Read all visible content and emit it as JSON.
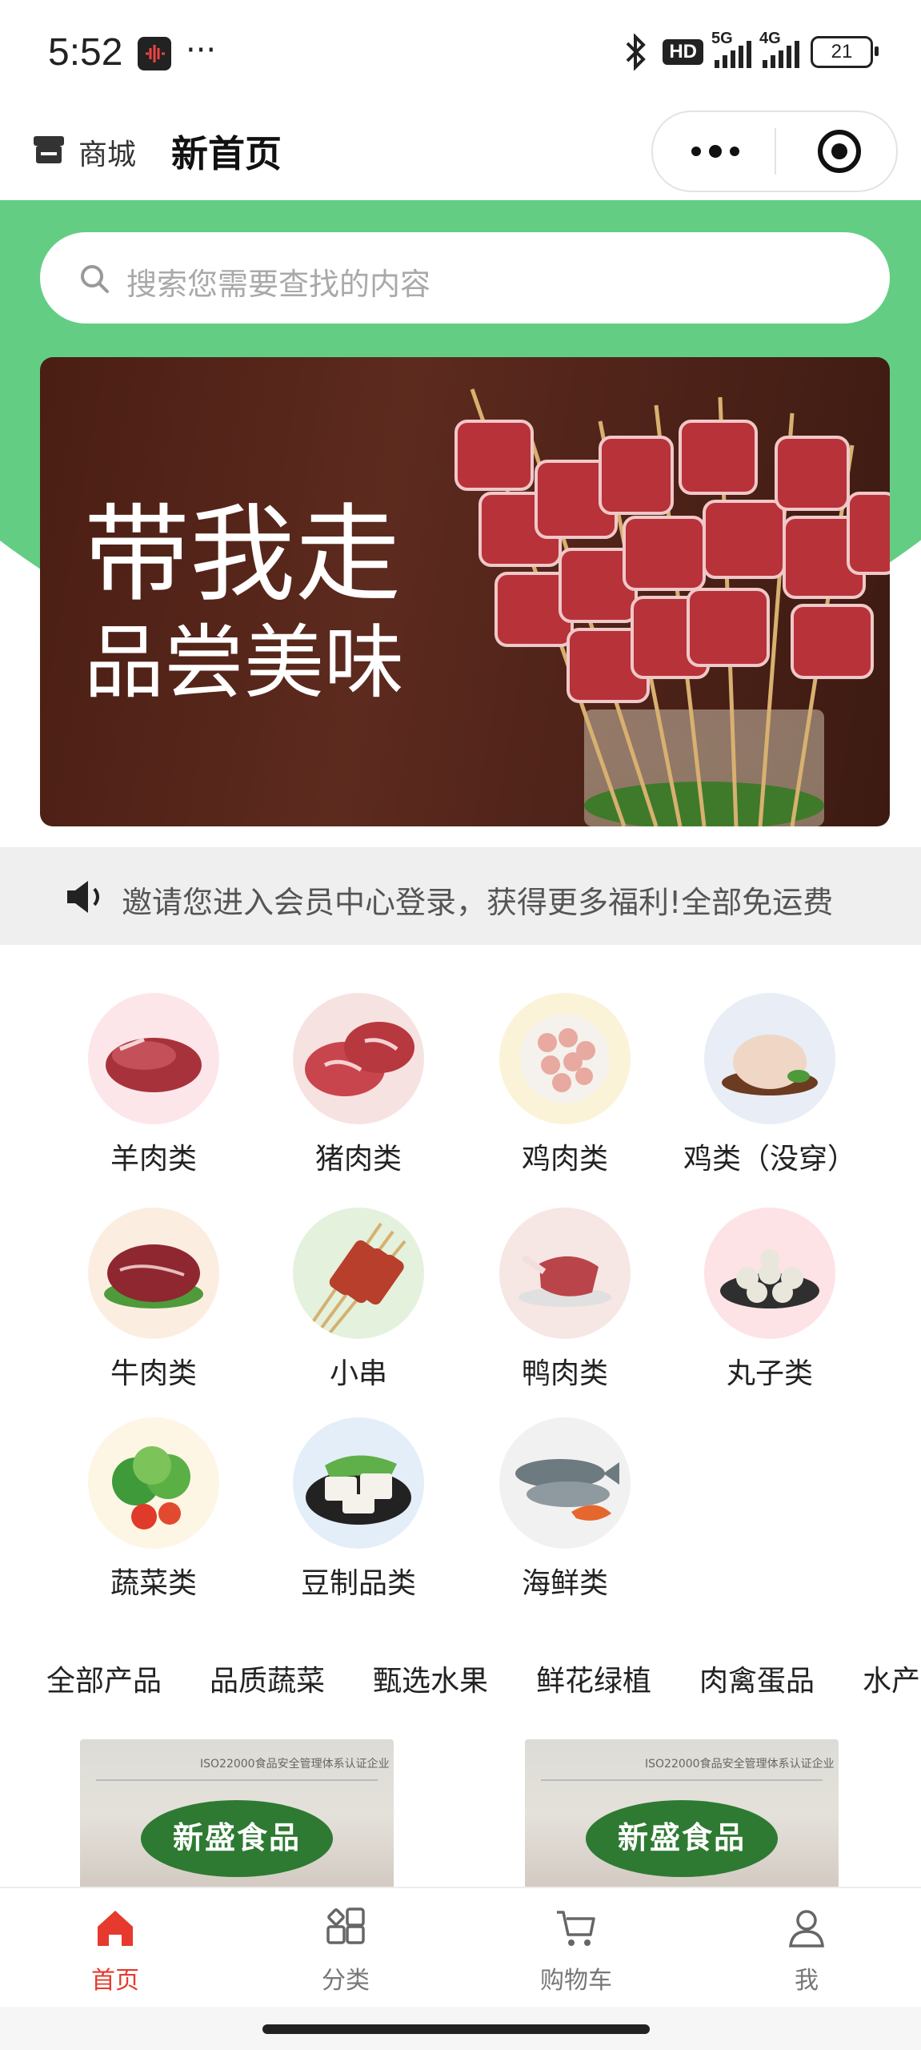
{
  "status_bar": {
    "time": "5:52",
    "more": "···",
    "hd_label": "HD",
    "network_1": "5G",
    "network_2": "4G",
    "battery": "21"
  },
  "header": {
    "store_label": "商城",
    "title": "新首页"
  },
  "search": {
    "placeholder": "搜索您需要查找的内容"
  },
  "banner": {
    "line1": "带我走",
    "line2": "品尝美味"
  },
  "notice": {
    "text": "邀请您进入会员中心登录，获得更多福利!全部免运费"
  },
  "categories": [
    {
      "label": "羊肉类",
      "icon": "lamb-meat"
    },
    {
      "label": "猪肉类",
      "icon": "pork-meat"
    },
    {
      "label": "鸡肉类",
      "icon": "chicken-pieces"
    },
    {
      "label": "鸡类（没穿）",
      "icon": "whole-chicken"
    },
    {
      "label": "牛肉类",
      "icon": "beef-meat"
    },
    {
      "label": "小串",
      "icon": "skewers"
    },
    {
      "label": "鸭肉类",
      "icon": "duck-meat"
    },
    {
      "label": "丸子类",
      "icon": "meatballs"
    },
    {
      "label": "蔬菜类",
      "icon": "vegetables"
    },
    {
      "label": "豆制品类",
      "icon": "tofu"
    },
    {
      "label": "海鲜类",
      "icon": "seafood"
    }
  ],
  "product_tabs": [
    "全部产品",
    "品质蔬菜",
    "甄选水果",
    "鲜花绿植",
    "肉禽蛋品",
    "水产"
  ],
  "products": [
    {
      "brand": "新盛食品",
      "note": "ISO22000食品安全管理体系认证企业"
    },
    {
      "brand": "新盛食品",
      "note": "ISO22000食品安全管理体系认证企业"
    }
  ],
  "bottom_nav": [
    {
      "label": "首页",
      "icon": "home-icon",
      "active": true
    },
    {
      "label": "分类",
      "icon": "category-icon",
      "active": false
    },
    {
      "label": "购物车",
      "icon": "cart-icon",
      "active": false
    },
    {
      "label": "我",
      "icon": "profile-icon",
      "active": false
    }
  ],
  "colors": {
    "brand_green": "#64cd84",
    "active_red": "#e53a2d"
  }
}
